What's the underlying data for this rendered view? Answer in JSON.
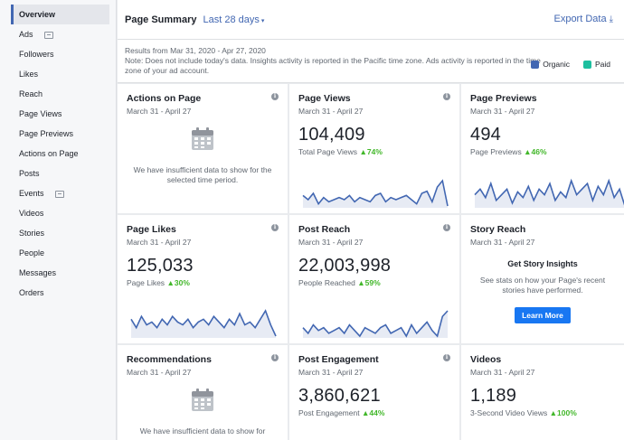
{
  "sidebar": {
    "items": [
      {
        "label": "Overview",
        "active": true
      },
      {
        "label": "Ads",
        "badge": true
      },
      {
        "label": "Followers"
      },
      {
        "label": "Likes"
      },
      {
        "label": "Reach"
      },
      {
        "label": "Page Views"
      },
      {
        "label": "Page Previews"
      },
      {
        "label": "Actions on Page"
      },
      {
        "label": "Posts"
      },
      {
        "label": "Events",
        "badge": true
      },
      {
        "label": "Videos"
      },
      {
        "label": "Stories"
      },
      {
        "label": "People"
      },
      {
        "label": "Messages"
      },
      {
        "label": "Orders"
      }
    ]
  },
  "header": {
    "title": "Page Summary",
    "range": "Last 28 days",
    "export": "Export Data"
  },
  "info": {
    "results": "Results from Mar 31, 2020 - Apr 27, 2020",
    "note": "Note: Does not include today's data. Insights activity is reported in the Pacific time zone. Ads activity is reported in the time zone of your ad account."
  },
  "legend": [
    {
      "label": "Organic",
      "color": "#4267b2"
    },
    {
      "label": "Paid",
      "color": "#1dbf9f"
    }
  ],
  "colors": {
    "accent": "#4267b2",
    "positive": "#42b72a",
    "button": "#1877f2"
  },
  "cards": {
    "actions": {
      "title": "Actions on Page",
      "sub": "March 31 - April 27",
      "message": "We have insufficient data to show for the selected time period."
    },
    "views": {
      "title": "Page Views",
      "sub": "March 31 - April 27",
      "value": "104,409",
      "metric": "Total Page Views",
      "pct": "74%",
      "spark": [
        13,
        11,
        14,
        9,
        12,
        10,
        11,
        12,
        11,
        13,
        10,
        12,
        11,
        10,
        13,
        14,
        10,
        12,
        11,
        12,
        13,
        11,
        9,
        14,
        15,
        10,
        17,
        20,
        8
      ]
    },
    "previews": {
      "title": "Page Previews",
      "sub": "March 31 - April 27",
      "value": "494",
      "metric": "Page Previews",
      "pct": "46%",
      "spark": [
        10,
        12,
        9,
        14,
        8,
        10,
        12,
        7,
        11,
        9,
        13,
        8,
        12,
        10,
        14,
        8,
        11,
        9,
        15,
        10,
        12,
        14,
        8,
        13,
        10,
        15,
        9,
        12,
        6
      ]
    },
    "likes": {
      "title": "Page Likes",
      "sub": "March 31 - April 27",
      "value": "125,033",
      "metric": "Page Likes",
      "pct": "30%",
      "spark": [
        12,
        9,
        13,
        10,
        11,
        9,
        12,
        10,
        13,
        11,
        10,
        12,
        9,
        11,
        12,
        10,
        13,
        11,
        9,
        12,
        10,
        14,
        10,
        11,
        9,
        12,
        15,
        10,
        6
      ]
    },
    "reach": {
      "title": "Post Reach",
      "sub": "March 31 - April 27",
      "value": "22,003,998",
      "metric": "People Reached",
      "pct": "59%",
      "spark": [
        12,
        10,
        13,
        11,
        12,
        10,
        11,
        12,
        10,
        13,
        11,
        9,
        12,
        11,
        10,
        12,
        13,
        10,
        11,
        12,
        9,
        13,
        10,
        12,
        14,
        11,
        9,
        16,
        18
      ]
    },
    "story": {
      "title": "Story Reach",
      "sub": "March 31 - April 27",
      "heading": "Get Story Insights",
      "text": "See stats on how your Page's recent stories have performed.",
      "button": "Learn More"
    },
    "recs": {
      "title": "Recommendations",
      "sub": "March 31 - April 27",
      "message": "We have insufficient data to show for"
    },
    "engagement": {
      "title": "Post Engagement",
      "sub": "March 31 - April 27",
      "value": "3,860,621",
      "metric": "Post Engagement",
      "pct": "44%"
    },
    "videos": {
      "title": "Videos",
      "sub": "March 31 - April 27",
      "value": "1,189",
      "metric": "3-Second Video Views",
      "pct": "100%"
    }
  }
}
